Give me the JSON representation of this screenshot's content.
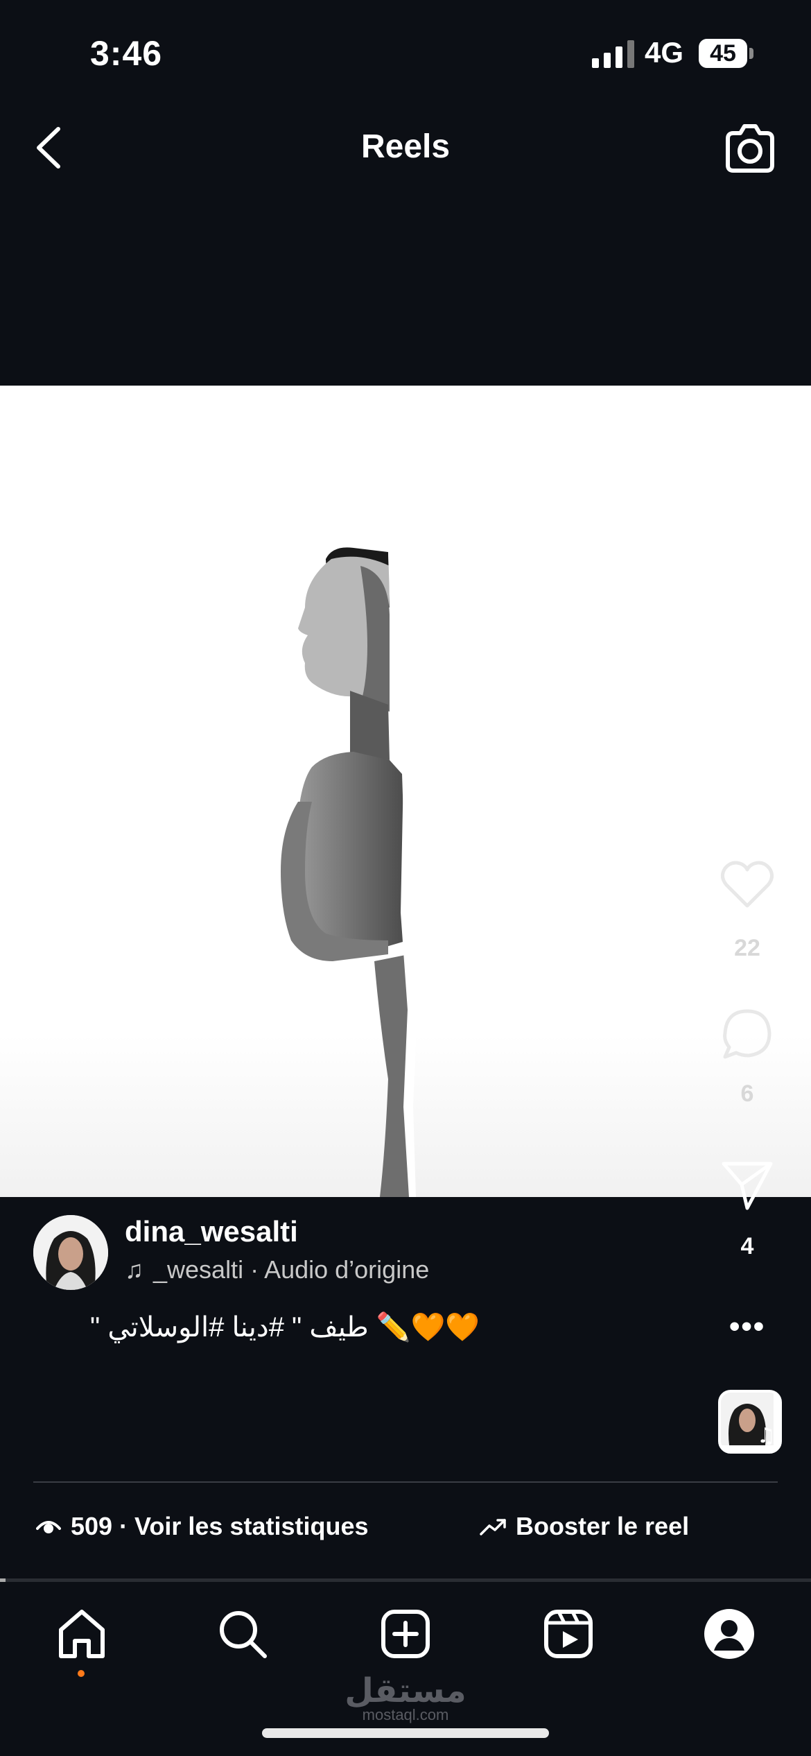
{
  "status_bar": {
    "time": "3:46",
    "network": "4G",
    "battery": "45"
  },
  "header": {
    "title": "Reels",
    "back_icon": "chevron-left-icon",
    "camera_icon": "camera-icon"
  },
  "actions": {
    "likes": "22",
    "comments": "6",
    "shares": "4"
  },
  "post": {
    "username": "dina_wesalti",
    "audio": "_wesalti · Audio d’origine",
    "caption": "\" طيف \" #دينا #الوسلاتي ✏️🧡🧡"
  },
  "footer": {
    "stats_label": "509 · Voir les statistiques",
    "boost_label": "Booster le reel"
  },
  "watermark": {
    "arabic": "مستقل",
    "latin": "mostaql.com"
  },
  "colors": {
    "background": "#0c0f15",
    "accent_dot": "#ff7a1a"
  }
}
